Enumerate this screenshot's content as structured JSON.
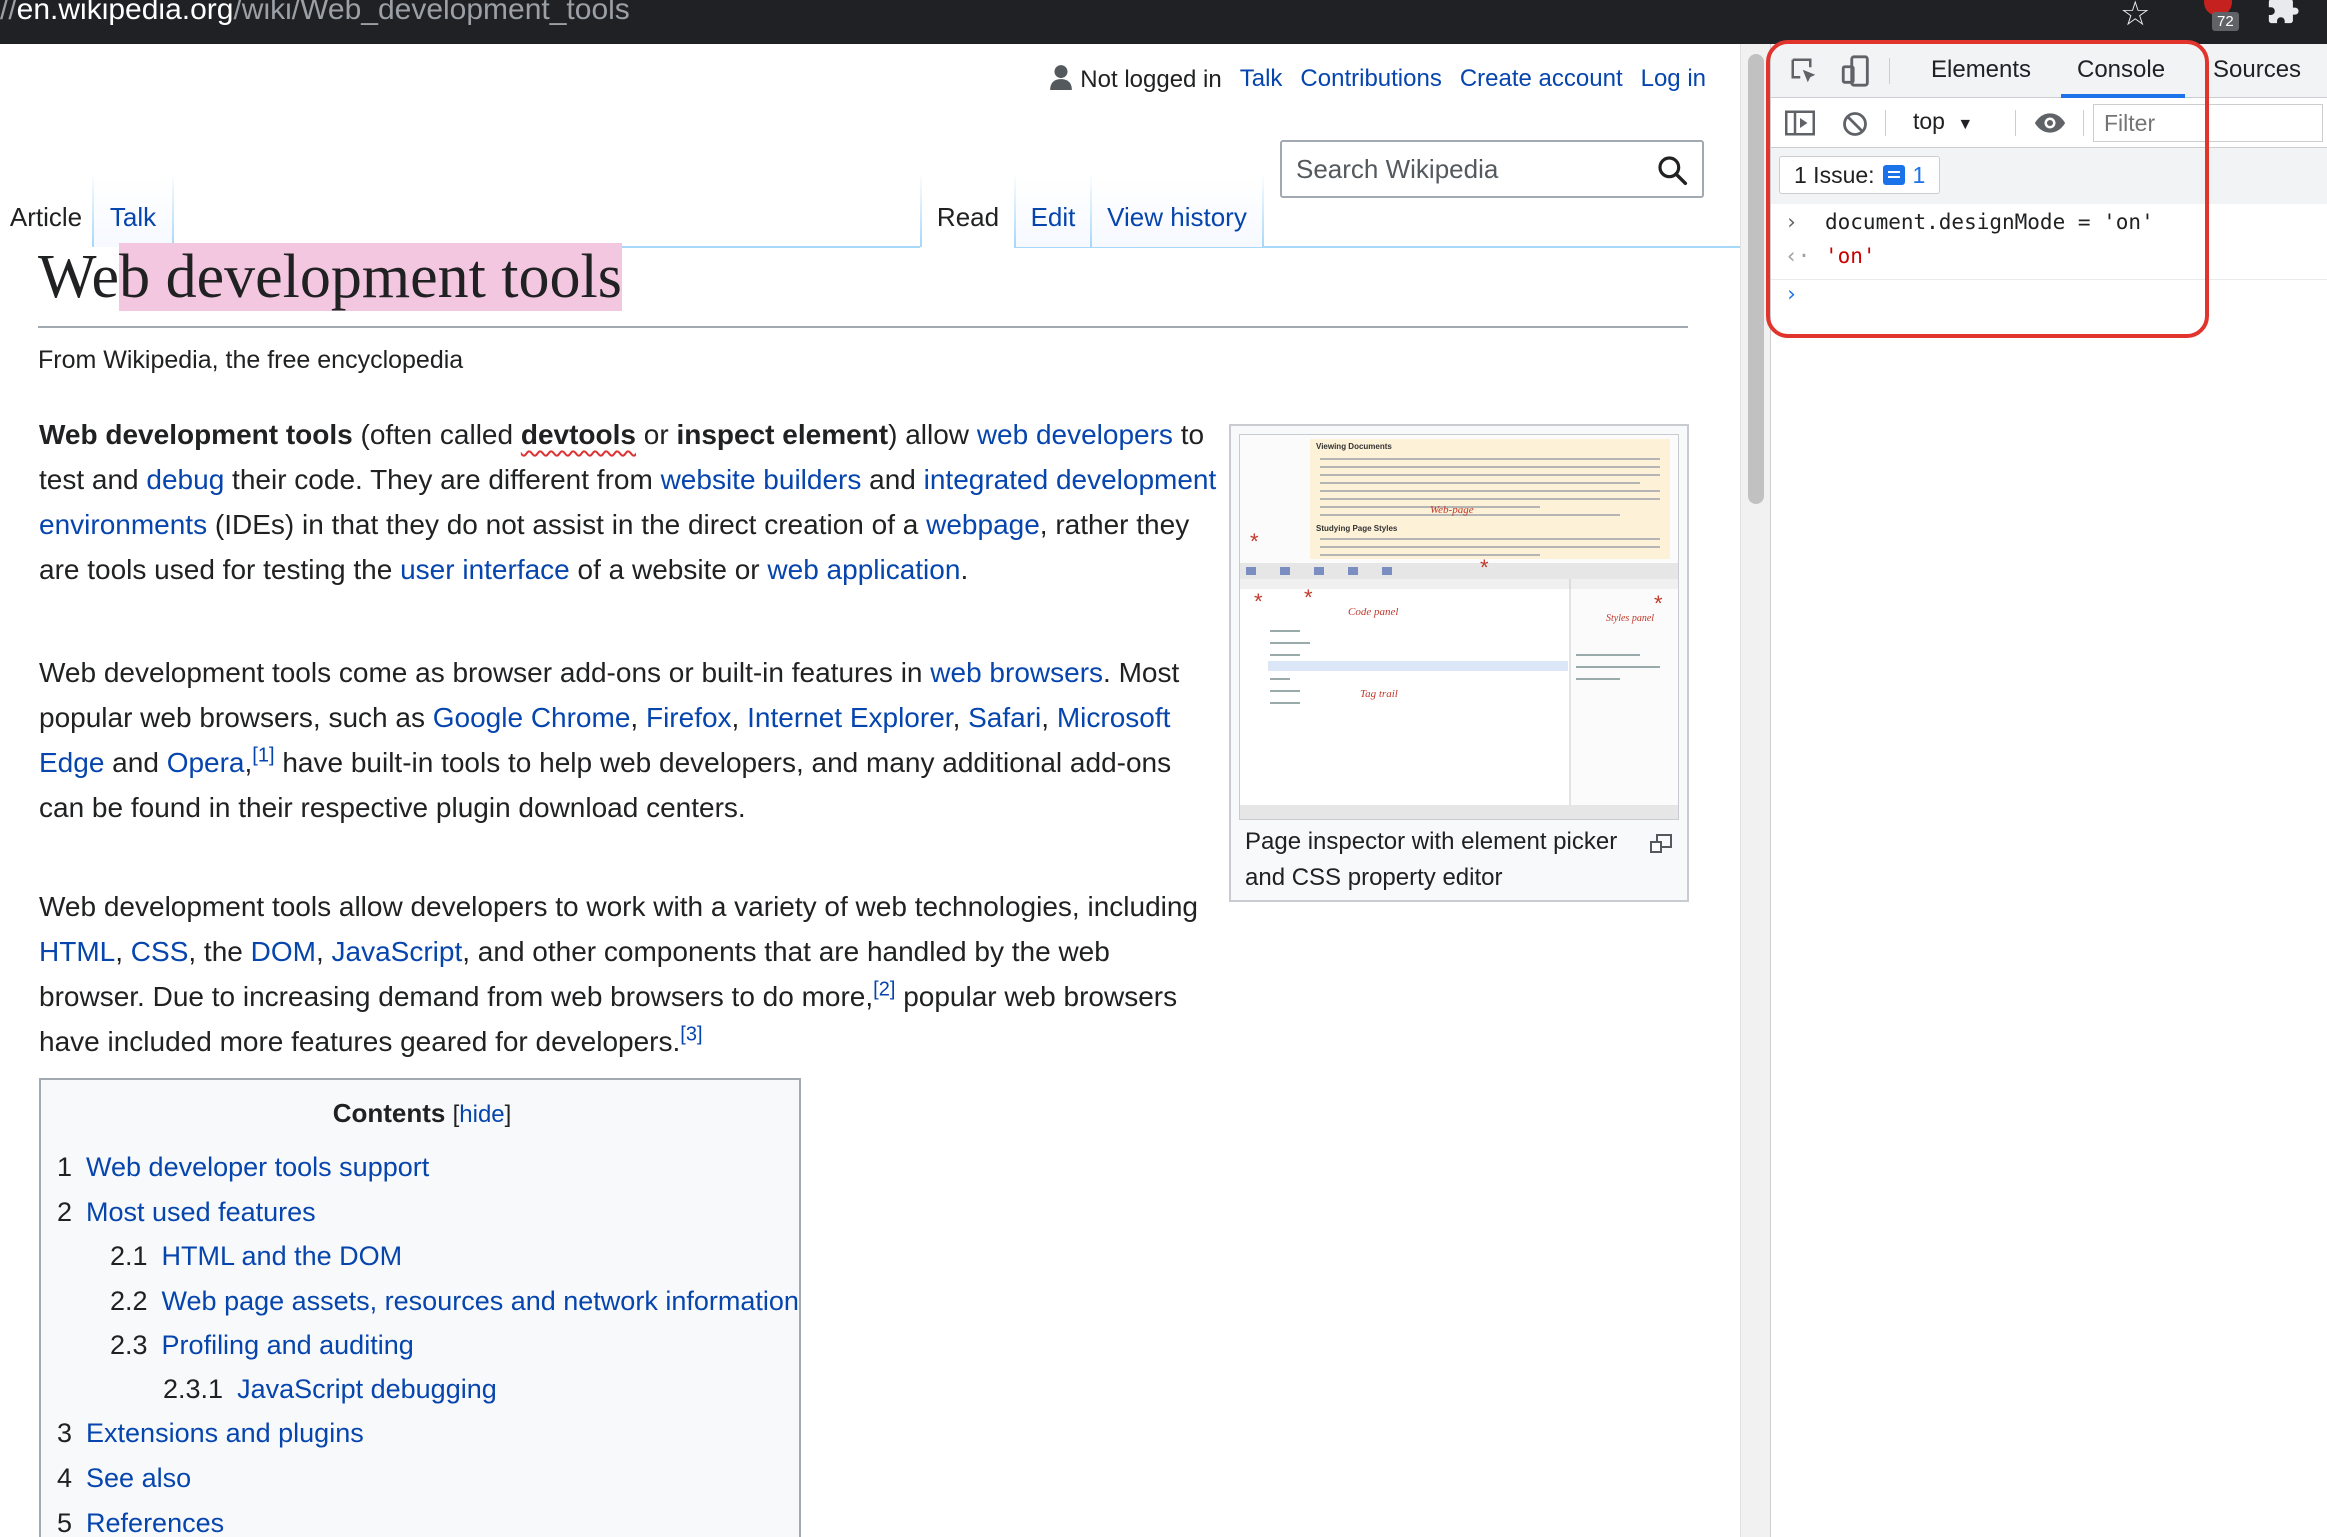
{
  "browser": {
    "url_prefix": "//",
    "url_host": "en.wikipedia.org",
    "url_path": "/wiki/Web_development_tools",
    "extension_badge": "72"
  },
  "personal": {
    "not_logged_in": "Not logged in",
    "talk": "Talk",
    "contributions": "Contributions",
    "create_account": "Create account",
    "log_in": "Log in"
  },
  "tabs": {
    "article": "Article",
    "talk": "Talk",
    "read": "Read",
    "edit": "Edit",
    "view_history": "View history"
  },
  "search": {
    "placeholder": "Search Wikipedia"
  },
  "article": {
    "title_pre": "We",
    "title_hl": "b development tools",
    "tagline": "From Wikipedia, the free encyclopedia",
    "p1": {
      "b1": "Web development tools",
      "t1": " (often called ",
      "b2": "devtools",
      "t2": " or ",
      "b3": "inspect element",
      "t3": ") allow ",
      "l1": "web developers",
      "t4": " to test and ",
      "l2": "debug",
      "t5": " their code. They are different from ",
      "l3": "website builders",
      "t6": " and ",
      "l4": "integrated development environments",
      "t7": " (IDEs) in that they do not assist in the direct creation of a ",
      "l5": "webpage",
      "t8": ", rather they are tools used for testing the ",
      "l6": "user interface",
      "t9": " of a website or ",
      "l7": "web application",
      "t10": "."
    },
    "p2": {
      "t1": "Web development tools come as browser add-ons or built-in features in ",
      "l1": "web browsers",
      "t2": ". Most popular web browsers, such as ",
      "l2": "Google Chrome",
      "t3": ", ",
      "l3": "Firefox",
      "t4": ", ",
      "l4": "Internet Explorer",
      "t5": ", ",
      "l5": "Safari",
      "t6": ", ",
      "l6": "Microsoft Edge",
      "t7": " and ",
      "l7": "Opera",
      "t8": ",",
      "ref1": "[1]",
      "t9": " have built-in tools to help web developers, and many additional add-ons can be found in their respective plugin download centers."
    },
    "p3": {
      "t1": "Web development tools allow developers to work with a variety of web technologies, including ",
      "l1": "HTML",
      "t2": ", ",
      "l2": "CSS",
      "t3": ", the ",
      "l3": "DOM",
      "t4": ", ",
      "l4": "JavaScript",
      "t5": ", and other components that are handled by the web browser. Due to increasing demand from web browsers to do more,",
      "ref2": "[2]",
      "t6": " popular web browsers have included more features geared for developers.",
      "ref3": "[3]"
    },
    "thumb_caption": "Page inspector with element picker and CSS property editor",
    "thumb_labels": {
      "viewing": "Viewing Documents",
      "studying": "Studying Page Styles",
      "web_page": "Web-page",
      "code_panel": "Code panel",
      "styles_panel": "Styles panel",
      "tag_trail": "Tag trail"
    }
  },
  "toc": {
    "title": "Contents",
    "hide": "hide",
    "items": [
      {
        "num": "1",
        "label": "Web developer tools support"
      },
      {
        "num": "2",
        "label": "Most used features"
      },
      {
        "num": "2.1",
        "label": "HTML and the DOM"
      },
      {
        "num": "2.2",
        "label": "Web page assets, resources and network information"
      },
      {
        "num": "2.3",
        "label": "Profiling and auditing"
      },
      {
        "num": "2.3.1",
        "label": "JavaScript debugging"
      },
      {
        "num": "3",
        "label": "Extensions and plugins"
      },
      {
        "num": "4",
        "label": "See also"
      },
      {
        "num": "5",
        "label": "References"
      }
    ]
  },
  "devtools": {
    "tabs": [
      "Elements",
      "Console",
      "Sources"
    ],
    "active_tab": "Console",
    "context": "top",
    "filter_placeholder": "Filter",
    "issues_label": "1 Issue:",
    "issues_count": "1",
    "console": {
      "input": "document.designMode = 'on'",
      "result": "'on'"
    }
  },
  "colors": {
    "link": "#0645ad",
    "highlight": "#f4c7e0",
    "annotation_box": "#e0342c",
    "devtools_accent": "#1a73e8"
  }
}
